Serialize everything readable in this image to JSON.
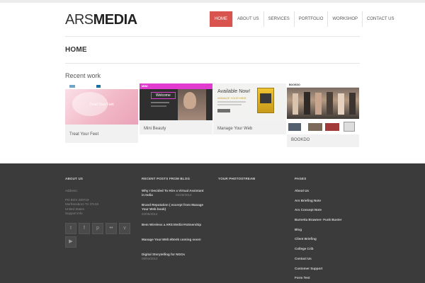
{
  "site": {
    "logo_light": "ARS",
    "logo_bold": "MEDIA"
  },
  "nav": {
    "items": [
      {
        "label": "HOME"
      },
      {
        "label": "ABOUT US"
      },
      {
        "label": "SERVICES"
      },
      {
        "label": "PORTFOLIO"
      },
      {
        "label": "WORKSHOP"
      },
      {
        "label": "CONTACT US"
      }
    ],
    "active": "HOME"
  },
  "page": {
    "title": "HOME"
  },
  "recent_work": {
    "title": "Recent work",
    "items": [
      {
        "caption": "Treat Your Feet",
        "thumb_text": "Treat Your Feet"
      },
      {
        "caption": "Mini Beauty",
        "thumb_text": "Welcome",
        "thumb_brand": "MINI"
      },
      {
        "caption": "Manage Your Web",
        "thumb_text": "Available Now!",
        "thumb_sub": "MANAGE YOUR WEB"
      },
      {
        "caption": "BOOKDO",
        "thumb_brand": "BOOKDO"
      }
    ]
  },
  "footer": {
    "about": {
      "heading": "ABOUT US",
      "lines": [
        "Address:",
        "PO BOX 330719",
        "Murfreesboro Tn 37133",
        "United States",
        "Support Info"
      ]
    },
    "recent_posts": {
      "heading": "RECENT POSTS FROM BLOG",
      "posts": [
        {
          "title": "Why I Decided To Hire a Virtual Assistant in India",
          "date": "02/26/2014"
        },
        {
          "title": "Brand Reputation ( excerpt from Manage Your Web book)",
          "date": "02/06/2014"
        },
        {
          "title": "Bem Wireless a ARS Media Partnership",
          "date": "08/12/2013"
        },
        {
          "title": "Manage Your Web ebook coming soon!",
          "date": "06/01/2013"
        },
        {
          "title": "Digital Storytelling for NGOs",
          "date": "08/04/2012"
        }
      ]
    },
    "photostream": {
      "heading": "YOUR PHOTOSTREAM"
    },
    "pages": {
      "heading": "PAGES",
      "links": [
        "About Us",
        "Ars Briefing Note",
        "Ars Concept Note",
        "Barnetta Brawner- Funk Buster",
        "Blog",
        "Client Briefing",
        "College Crib",
        "Contact Us",
        "Customer Support",
        "Form Test"
      ]
    },
    "social": [
      "twitter-icon",
      "facebook-icon",
      "pinterest-icon",
      "flickr-icon",
      "vimeo-icon",
      "linkedin-icon",
      "youtube-icon"
    ]
  },
  "colors": {
    "accent": "#d9534f",
    "footer_bg": "#3b3b3b"
  }
}
